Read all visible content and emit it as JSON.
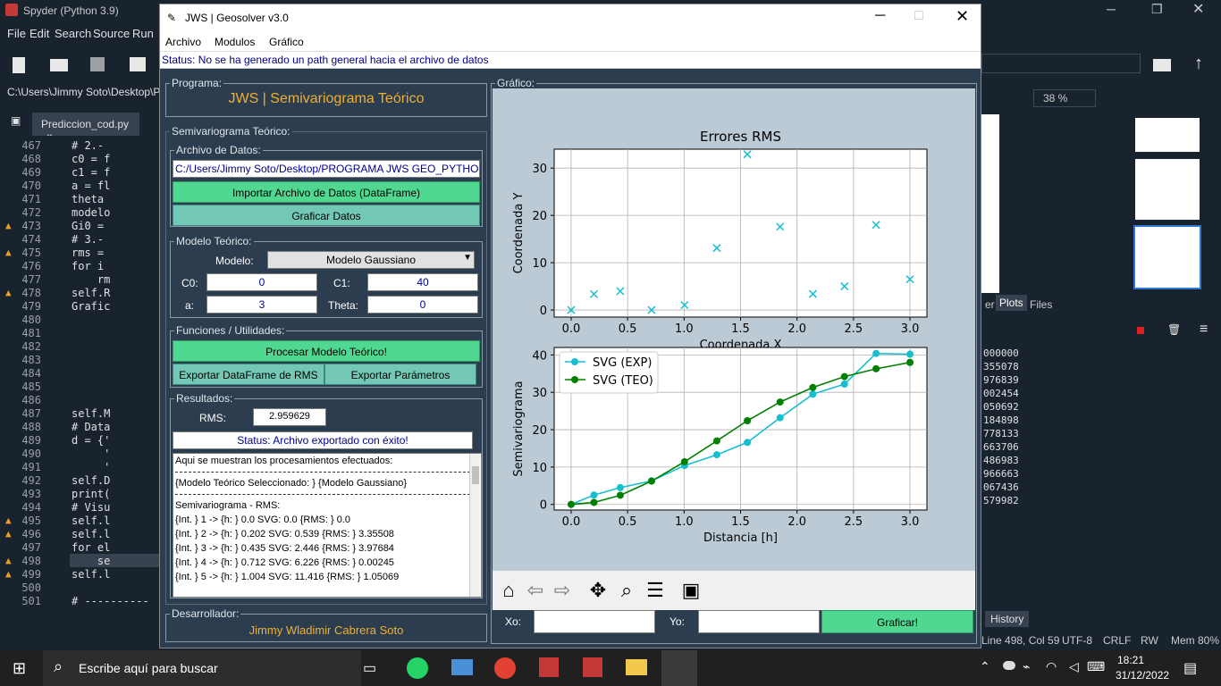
{
  "spyder": {
    "title": "Spyder (Python 3.9)",
    "menu": [
      "File",
      "Edit",
      "Search",
      "Source",
      "Run"
    ],
    "path": "C:\\Users\\Jimmy Soto\\Desktop\\PRO",
    "tab": "Prediccion_cod.py",
    "lines": [
      {
        "n": "467",
        "c": "# 2.-"
      },
      {
        "n": "468",
        "c": "c0 = f"
      },
      {
        "n": "469",
        "c": "c1 = f"
      },
      {
        "n": "470",
        "c": "a = fl"
      },
      {
        "n": "471",
        "c": "theta"
      },
      {
        "n": "472",
        "c": "modelo"
      },
      {
        "n": "473",
        "c": "Gi0 ="
      },
      {
        "n": "474",
        "c": "# 3.-"
      },
      {
        "n": "475",
        "c": "rms ="
      },
      {
        "n": "476",
        "c": "for i"
      },
      {
        "n": "477",
        "c": "    rm"
      },
      {
        "n": "478",
        "c": "self.R"
      },
      {
        "n": "479",
        "c": "Grafic"
      },
      {
        "n": "480",
        "c": ""
      },
      {
        "n": "481",
        "c": ""
      },
      {
        "n": "482",
        "c": ""
      },
      {
        "n": "483",
        "c": ""
      },
      {
        "n": "484",
        "c": ""
      },
      {
        "n": "485",
        "c": ""
      },
      {
        "n": "486",
        "c": ""
      },
      {
        "n": "487",
        "c": "self.M"
      },
      {
        "n": "488",
        "c": "# Data"
      },
      {
        "n": "489",
        "c": "d = {'"
      },
      {
        "n": "490",
        "c": "     '"
      },
      {
        "n": "491",
        "c": "     '"
      },
      {
        "n": "492",
        "c": "self.D"
      },
      {
        "n": "493",
        "c": "print("
      },
      {
        "n": "494",
        "c": "# Visu"
      },
      {
        "n": "495",
        "c": "self.l"
      },
      {
        "n": "496",
        "c": "self.l"
      },
      {
        "n": "497",
        "c": "for el"
      },
      {
        "n": "498",
        "c": "    se"
      },
      {
        "n": "499",
        "c": "self.l"
      },
      {
        "n": "500",
        "c": ""
      },
      {
        "n": "501",
        "c": "# ----------"
      }
    ],
    "zoom": "38 %",
    "right_tabs": [
      "er",
      "Plots",
      "Files"
    ],
    "console_values": [
      "000000",
      "355078",
      "976839",
      "002454",
      "050692",
      "184898",
      "778133",
      "663706",
      "486983",
      "966663",
      "067436",
      "579982"
    ],
    "history_tab": "History",
    "status": {
      "pos": "Line 498, Col 59",
      "enc": "UTF-8",
      "eol": "CRLF",
      "rw": "RW",
      "mem": "Mem 80%"
    }
  },
  "taskbar": {
    "search": "Escribe aquí para buscar",
    "time": "18:21",
    "date": "31/12/2022"
  },
  "jws": {
    "title": "JWS | Geosolver v3.0",
    "menu": [
      "Archivo",
      "Modulos",
      "Gráfico"
    ],
    "status": "Status: No se ha generado un path general hacia el archivo de datos",
    "programa_title": "Programa:",
    "programa_name": "JWS | Semivariograma Teórico",
    "semi_title": "Semivariograma Teórico:",
    "archivo_title": "Archivo de Datos:",
    "path_value": "C:/Users/Jimmy Soto/Desktop/PROGRAMA JWS GEO_PYTHON/F",
    "btn_import": "Importar Archivo de Datos (DataFrame)",
    "btn_graficar_datos": "Graficar Datos",
    "modelo_title": "Modelo Teórico:",
    "modelo_label": "Modelo:",
    "modelo_value": "Modelo Gaussiano",
    "c0_label": "C0:",
    "c0": "0",
    "c1_label": "C1:",
    "c1": "40",
    "a_label": "a:",
    "a": "3",
    "theta_label": "Theta:",
    "theta": "0",
    "func_title": "Funciones / Utilidades:",
    "btn_procesar": "Procesar Modelo Teórico!",
    "btn_export_rms": "Exportar DataFrame de RMS",
    "btn_export_params": "Exportar Parámetros",
    "res_title": "Resultados:",
    "rms_label": "RMS:",
    "rms": "2.959629",
    "res_status": "Status: Archivo exportado con éxito!",
    "log": [
      "Aqui se muestran los procesamientos efectuados:",
      "---",
      "{Modelo Teórico Seleccionado: } {Modelo Gaussiano}",
      "---",
      "Semivariograma - RMS:",
      "{Int. } 1 -> {h: } 0.0 SVG: 0.0 {RMS: } 0.0",
      "{Int. } 2 -> {h: } 0.202 SVG: 0.539 {RMS: } 3.35508",
      "{Int. } 3 -> {h: } 0.435 SVG: 2.446 {RMS: } 3.97684",
      "{Int. } 4 -> {h: } 0.712 SVG: 6.226 {RMS: } 0.00245",
      "{Int. } 5 -> {h: } 1.004 SVG: 11.416 {RMS: } 1.05069"
    ],
    "dev_title": "Desarrollador:",
    "dev_name": "Jimmy Wladimir Cabrera Soto",
    "graf_title": "Gráfico:",
    "xo_label": "Xo:",
    "yo_label": "Yo:",
    "btn_graficar": "Graficar!"
  },
  "chart_data": [
    {
      "type": "scatter",
      "title": "Errores RMS",
      "xlabel": "Coordenada X",
      "ylabel": "Coordenada Y",
      "xlim": [
        -0.15,
        3.15
      ],
      "ylim": [
        -1.5,
        34
      ],
      "xticks": [
        "0.0",
        "0.5",
        "1.0",
        "1.5",
        "2.0",
        "2.5",
        "3.0"
      ],
      "yticks": [
        "0",
        "10",
        "20",
        "30"
      ],
      "x": [
        0.0,
        0.202,
        0.435,
        0.712,
        1.004,
        1.29,
        1.56,
        1.85,
        2.14,
        2.42,
        2.7,
        3.0
      ],
      "y": [
        0.0,
        3.36,
        3.98,
        0.0,
        1.05,
        13.1,
        32.9,
        17.6,
        3.4,
        5.0,
        18.0,
        6.5
      ],
      "color": "#17becf",
      "grid": true
    },
    {
      "type": "line",
      "xlabel": "Distancia [h]",
      "ylabel": "Semivariograma",
      "xlim": [
        -0.15,
        3.15
      ],
      "ylim": [
        -1.5,
        42
      ],
      "xticks": [
        "0.0",
        "0.5",
        "1.0",
        "1.5",
        "2.0",
        "2.5",
        "3.0"
      ],
      "yticks": [
        "0",
        "10",
        "20",
        "30",
        "40"
      ],
      "x": [
        0.0,
        0.202,
        0.435,
        0.712,
        1.004,
        1.29,
        1.56,
        1.85,
        2.14,
        2.42,
        2.7,
        3.0
      ],
      "series": [
        {
          "name": "SVG (EXP)",
          "color": "#17becf",
          "values": [
            0.0,
            2.5,
            4.5,
            6.3,
            10.4,
            13.3,
            16.6,
            23.2,
            29.5,
            32.2,
            40.4,
            40.2
          ]
        },
        {
          "name": "SVG (TEO)",
          "color": "#008000",
          "values": [
            0.0,
            0.54,
            2.45,
            6.23,
            11.42,
            17.0,
            22.4,
            27.4,
            31.3,
            34.2,
            36.3,
            38.0
          ]
        }
      ],
      "legend": "top-left",
      "grid": true
    }
  ]
}
